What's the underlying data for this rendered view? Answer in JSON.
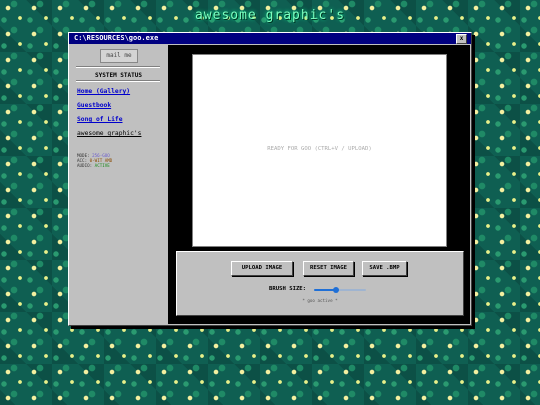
{
  "page": {
    "title": "awesome graphic's"
  },
  "window": {
    "title": "C:\\RESOURCES\\goo.exe",
    "close_label": "x"
  },
  "sidebar": {
    "mail_alt": "mail me",
    "status_title": "SYSTEM STATUS",
    "links": [
      {
        "label": "Home (Gallery)"
      },
      {
        "label": "Guestbook"
      },
      {
        "label": "Song of Life"
      },
      {
        "label": "awesome graphic's"
      }
    ],
    "sysinfo": {
      "mode_label": "MODE:",
      "mode_value": "256-GOO",
      "acc_label": "ACC:",
      "acc_value": "0-WIT AMD",
      "audio_label": "AUDIO:",
      "audio_value": "ACTIVE"
    }
  },
  "canvas": {
    "placeholder": "READY FOR GOO (CTRL+V / UPLOAD)"
  },
  "controls": {
    "upload_label": "UPLOAD IMAGE",
    "reset_label": "RESET IMAGE",
    "save_label": "SAVE .BMP",
    "brush_label": "BRUSH SIZE:",
    "brush_value": 0.42,
    "status": "* goo active *"
  },
  "colors": {
    "titlebar": "#000080",
    "link": "#0000cc",
    "heading_glow": "#7dffc0",
    "slider": "#1f6fd6"
  }
}
